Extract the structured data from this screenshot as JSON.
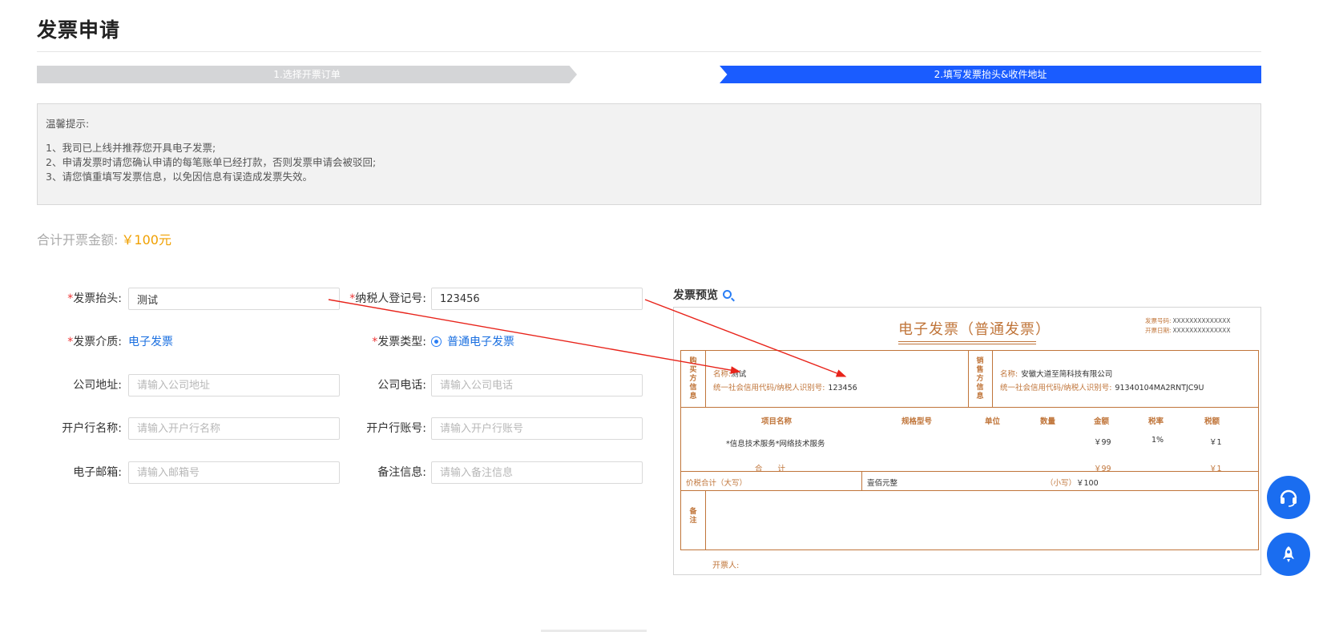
{
  "page": {
    "title": "发票申请"
  },
  "steps": [
    {
      "label": "1.选择开票订单",
      "active": false
    },
    {
      "label": "2.填写发票抬头&收件地址",
      "active": true
    }
  ],
  "tips": {
    "title": "温馨提示:",
    "lines": [
      "1、我司已上线并推荐您开具电子发票;",
      "2、申请发票时请您确认申请的每笔账单已经打款，否则发票申请会被驳回;",
      "3、请您慎重填写发票信息，以免因信息有误造成发票失效。"
    ]
  },
  "total": {
    "label": "合计开票金额:",
    "amount": "￥100元"
  },
  "form": {
    "required_mark": "*",
    "invoice_title": {
      "label": "发票抬头:",
      "value": "测试"
    },
    "taxpayer_id": {
      "label": "纳税人登记号:",
      "value": "123456"
    },
    "medium": {
      "label": "发票介质:",
      "value": "电子发票"
    },
    "type": {
      "label": "发票类型:",
      "option": "普通电子发票",
      "selected": true
    },
    "company_address": {
      "label": "公司地址:",
      "placeholder": "请输入公司地址"
    },
    "company_phone": {
      "label": "公司电话:",
      "placeholder": "请输入公司电话"
    },
    "bank_name": {
      "label": "开户行名称:",
      "placeholder": "请输入开户行名称"
    },
    "bank_account": {
      "label": "开户行账号:",
      "placeholder": "请输入开户行账号"
    },
    "email": {
      "label": "电子邮箱:",
      "placeholder": "请输入邮箱号"
    },
    "remark": {
      "label": "备注信息:",
      "placeholder": "请输入备注信息"
    }
  },
  "preview": {
    "title": "发票预览",
    "invoice_title": "电子发票（普通发票）",
    "invoice_no_label": "发票号码:",
    "invoice_no": "XXXXXXXXXXXXXX",
    "invoice_date_label": "开票日期:",
    "invoice_date": "XXXXXXXXXXXXXX",
    "buyer": {
      "section_label": "购买方信息",
      "name_label": "名称:",
      "name": "测试",
      "tax_label": "统一社会信用代码/纳税人识别号:",
      "tax_id": "123456"
    },
    "seller": {
      "section_label": "销售方信息",
      "name_label": "名称:",
      "name": "安徽大道至简科技有限公司",
      "tax_label": "统一社会信用代码/纳税人识别号:",
      "tax_id": "91340104MA2RNTJC9U"
    },
    "columns": [
      "项目名称",
      "规格型号",
      "单位",
      "数量",
      "金额",
      "税率",
      "税额"
    ],
    "item": {
      "name": "*信息技术服务*网络技术服务",
      "amount": "￥99",
      "tax_rate": "1%",
      "tax": "￥1"
    },
    "sum": {
      "label": "合　　计",
      "amount": "￥99",
      "tax": "￥1"
    },
    "total_in_words_label": "价税合计（大写）",
    "total_in_words": "壹佰元整",
    "total_small_label": "（小写）",
    "total_small": "￥100",
    "remark_label": "备注",
    "drawer_label": "开票人:"
  },
  "float_buttons": {
    "service_icon": "headset-icon",
    "top_icon": "rocket-icon"
  },
  "colors": {
    "primary": "#1a5cff",
    "invoice": "#c0753a",
    "amount": "#f0a000",
    "required": "#e33333"
  }
}
